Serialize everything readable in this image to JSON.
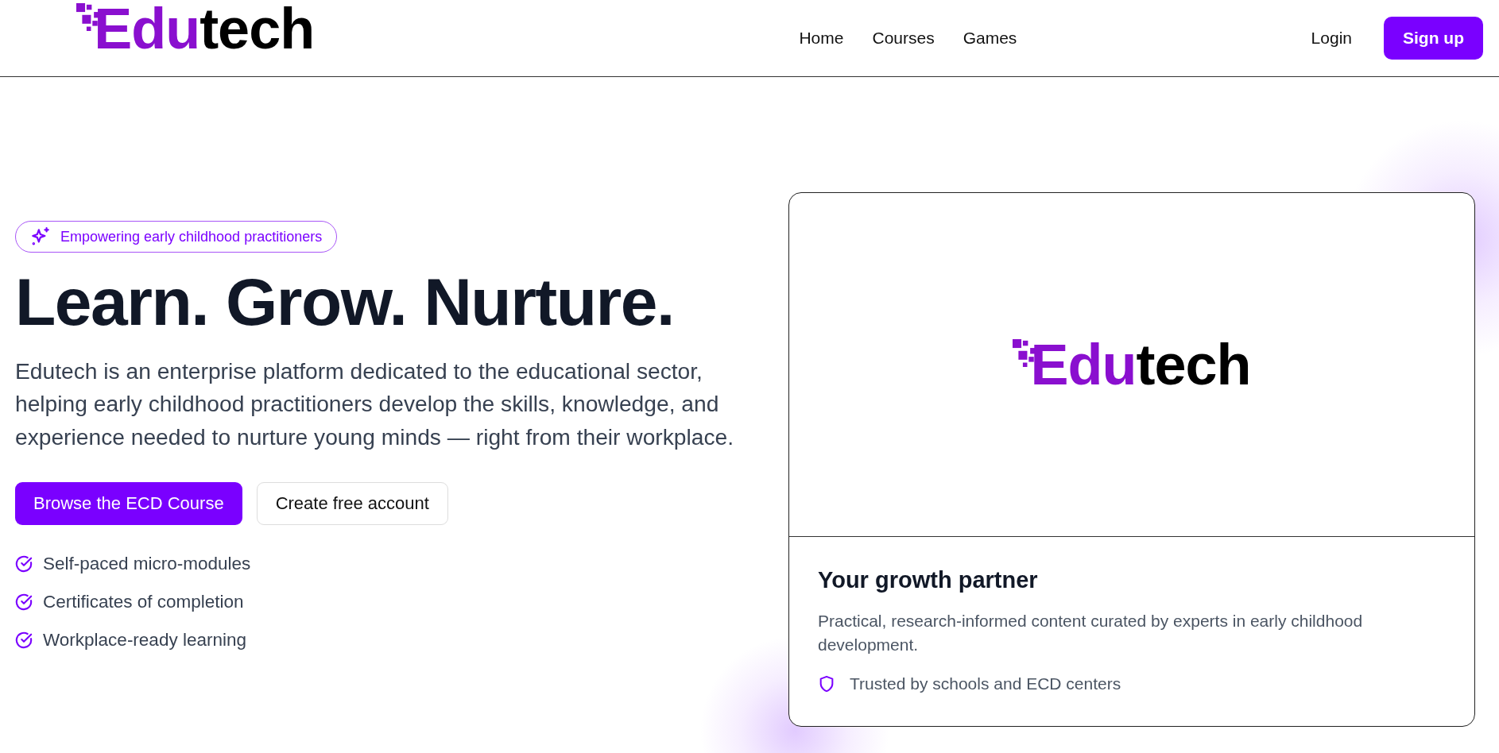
{
  "header": {
    "logo": {
      "accent": "Edu",
      "rest": "tech"
    },
    "nav": [
      {
        "label": "Home"
      },
      {
        "label": "Courses"
      },
      {
        "label": "Games"
      }
    ],
    "login": "Login",
    "signup": "Sign up"
  },
  "hero": {
    "badge": "Empowering early childhood practitioners",
    "title": "Learn. Grow. Nurture.",
    "description": "Edutech is an enterprise platform dedicated to the educational sector, helping early childhood practitioners develop the skills, knowledge, and experience needed to nurture young minds — right from their workplace.",
    "buttons": [
      {
        "label": "Browse the ECD Course",
        "kind": "primary"
      },
      {
        "label": "Create free account",
        "kind": "secondary"
      }
    ],
    "features": [
      "Self-paced micro-modules",
      "Certificates of completion",
      "Workplace-ready learning"
    ]
  },
  "card": {
    "logo": {
      "accent": "Edu",
      "rest": "tech"
    },
    "title": "Your growth partner",
    "description": "Practical, research-informed content curated by experts in early childhood development.",
    "trust": "Trusted by schools and ECD centers"
  }
}
